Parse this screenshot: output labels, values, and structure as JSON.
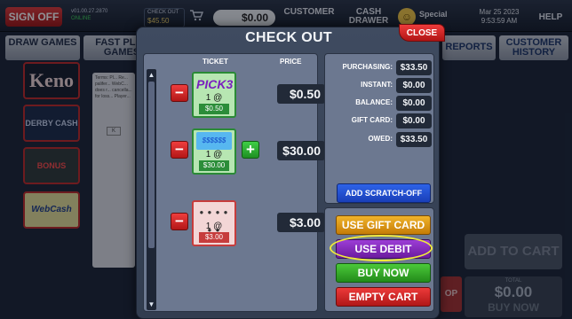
{
  "topbar": {
    "sign_off": "SIGN OFF",
    "version": "v01.00.27.2870",
    "status": "ONLINE",
    "checkout_label": "CHECK OUT",
    "checkout_amount": "$45.50",
    "cart_icon": "cart-icon",
    "total": "$0.00",
    "customer_label": "CUSTOMER",
    "cash_label": "CASH DRAWER",
    "special_label": "Special",
    "special_icon": "smiley-icon",
    "date": "Mar 25 2023",
    "time": "9:53:59 AM",
    "help": "HELP"
  },
  "tabs": {
    "draw_games": "DRAW GAMES",
    "fast_play": "FAST PLAY GAMES",
    "reports": "REPORTS",
    "customer_history": "CUSTOMER HISTORY"
  },
  "games": {
    "keno": "Keno",
    "derby": "DERBY CASH",
    "bonus": "BONUS CASH",
    "webcash": "WebCash"
  },
  "background": {
    "panel_text": "Terms: Pl... Re... palifer... WebC... does r... cancella... for loss... Player...",
    "key_label": "K",
    "add_to_cart": "ADD TO CART",
    "total_label": "TOTAL",
    "total_amount": "$0.00",
    "buy_now": "BUY NOW",
    "stop_label": "OP"
  },
  "modal": {
    "title": "CHECK OUT",
    "close": "CLOSE",
    "ticket_header": "TICKET",
    "price_header": "PRICE",
    "tickets": [
      {
        "art": "PICK3",
        "qty": "1 @",
        "unit_price": "$0.50",
        "price": "$0.50",
        "has_plus": false
      },
      {
        "art": "$$$$$$",
        "qty": "1 @",
        "unit_price": "$30.00",
        "price": "$30.00",
        "has_plus": true
      },
      {
        "art": "● ● ● ● ● ●",
        "qty": "1 @",
        "unit_price": "$3.00",
        "price": "$3.00",
        "has_plus": false
      }
    ],
    "minus_label": "−",
    "plus_label": "+",
    "scroll_up": "▲",
    "scroll_down": "▼",
    "summary": [
      {
        "label": "PURCHASING:",
        "value": "$33.50"
      },
      {
        "label": "INSTANT:",
        "value": "$0.00"
      },
      {
        "label": "BALANCE:",
        "value": "$0.00"
      },
      {
        "label": "GIFT CARD:",
        "value": "$0.00"
      },
      {
        "label": "OWED:",
        "value": "$33.50"
      }
    ],
    "add_scratch_off": "ADD SCRATCH-OFF",
    "use_gift_card": "USE GIFT CARD",
    "use_debit": "USE DEBIT",
    "buy_now": "BUY NOW",
    "empty_cart": "EMPTY CART"
  },
  "colors": {
    "accent_red": "#d62a2a",
    "accent_green": "#2fa827",
    "accent_blue": "#2450d6",
    "accent_purple": "#8229bd",
    "accent_gold": "#e39d18",
    "highlight_ring": "#f0ea3a"
  }
}
